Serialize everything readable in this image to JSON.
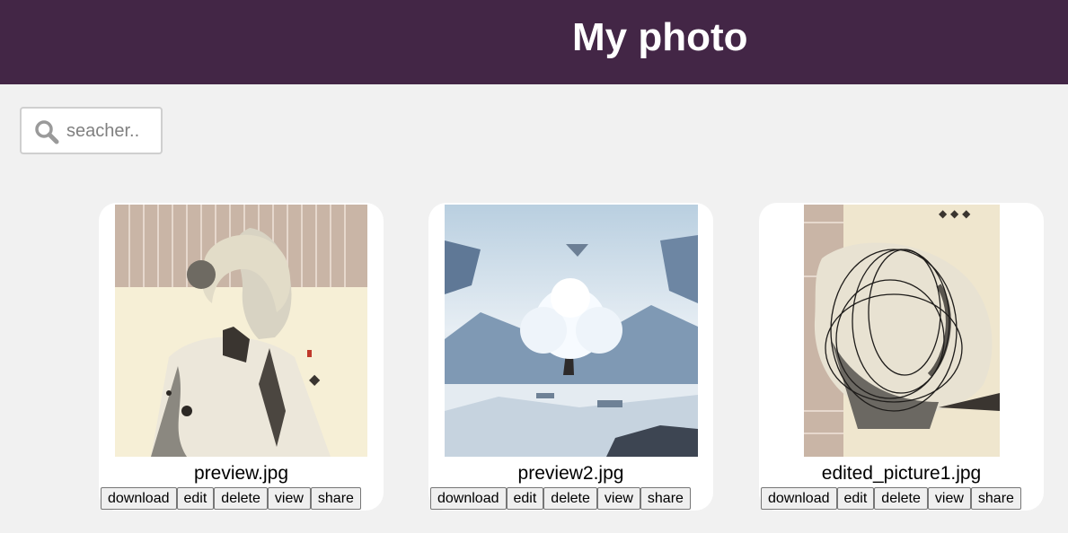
{
  "header": {
    "title": "My photo",
    "background": "#432646"
  },
  "search": {
    "placeholder": "seacher..",
    "value": "",
    "icon": "search-icon"
  },
  "photos": [
    {
      "filename": "preview.jpg",
      "image": "ink-painting-girl-portrait",
      "actions": [
        "download",
        "edit",
        "delete",
        "view",
        "share"
      ]
    },
    {
      "filename": "preview2.jpg",
      "image": "white-tree-snowy-landscape",
      "actions": [
        "download",
        "edit",
        "delete",
        "view",
        "share"
      ]
    },
    {
      "filename": "edited_picture1.jpg",
      "image": "edited-scribbled-portrait",
      "actions": [
        "download",
        "edit",
        "delete",
        "view",
        "share"
      ]
    }
  ]
}
